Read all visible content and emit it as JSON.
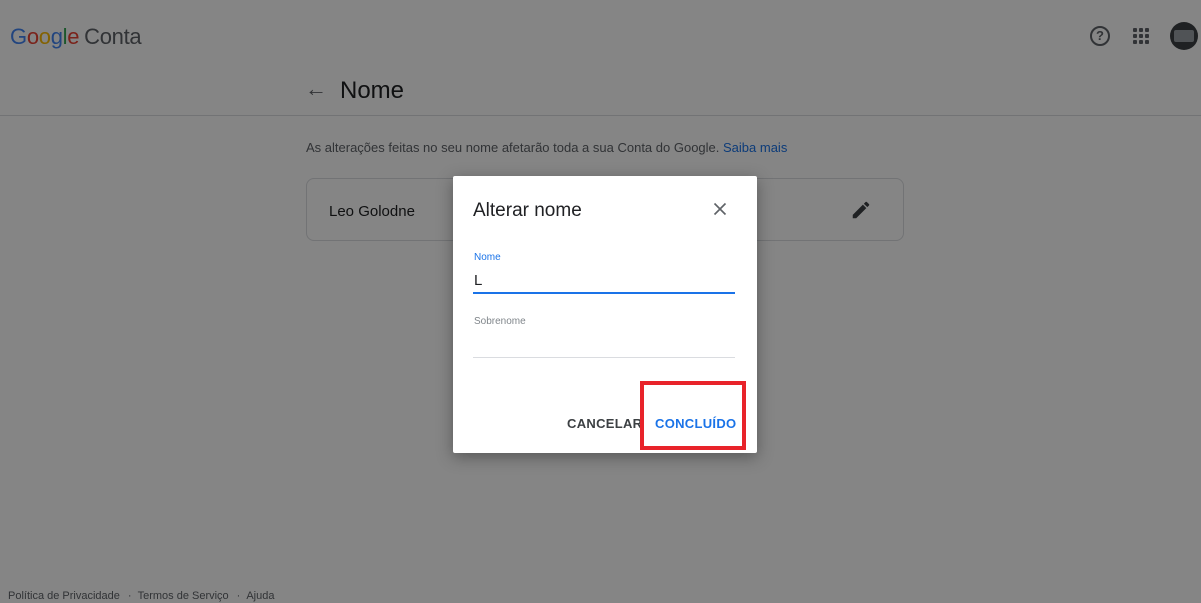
{
  "header": {
    "brand_letters": [
      "G",
      "o",
      "o",
      "g",
      "l",
      "e"
    ],
    "brand_suffix": "Conta",
    "brand_colors": [
      "#4285f4",
      "#ea4335",
      "#fbbc05",
      "#4285f4",
      "#34a853",
      "#ea4335"
    ],
    "icons": [
      "help-icon",
      "apps-icon",
      "avatar"
    ]
  },
  "subheader": {
    "back_icon": "←",
    "title": "Nome"
  },
  "main": {
    "info_text": "As alterações feitas no seu nome afetarão toda a sua Conta do Google.",
    "learn_more": "Saiba mais",
    "current_name": "Leo Golodne"
  },
  "dialog": {
    "title": "Alterar nome",
    "first_name_label": "Nome",
    "first_name_value": "L",
    "last_name_label": "Sobrenome",
    "last_name_value": "",
    "cancel_label": "CANCELAR",
    "done_label": "CONCLUÍDO"
  },
  "footer": {
    "links": [
      "Política de Privacidade",
      "Termos de Serviço",
      "Ajuda"
    ],
    "separator": "·"
  },
  "colors": {
    "accent": "#1a73e8",
    "highlight": "#e8232a",
    "overlay": "rgba(0,0,0,0.48)"
  }
}
